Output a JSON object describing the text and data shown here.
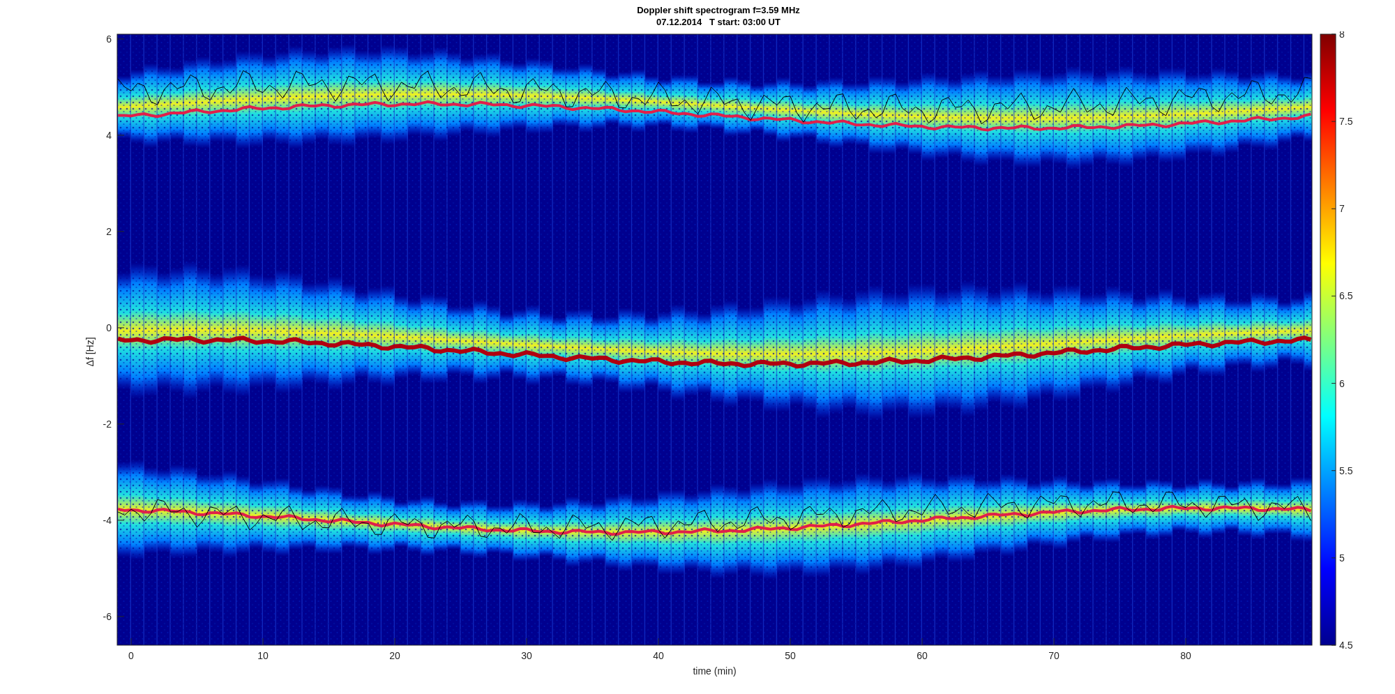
{
  "figure": {
    "title": "Doppler shift spectrogram f=3.59 MHz",
    "subtitle": "07.12.2014   T start: 03:00 UT"
  },
  "axes": {
    "ylabel": "Δf [Hz]",
    "xlabel": "time (min)",
    "xticks": [
      "0",
      "10",
      "20",
      "30",
      "40",
      "50",
      "60",
      "70",
      "80"
    ],
    "yticks": [
      "6",
      "4",
      "2",
      "0",
      "-2",
      "-4",
      "-6"
    ]
  },
  "colorbar": {
    "ticks": [
      "8",
      "7.5",
      "7",
      "6.5",
      "6",
      "5.5",
      "5",
      "4.5"
    ]
  }
}
